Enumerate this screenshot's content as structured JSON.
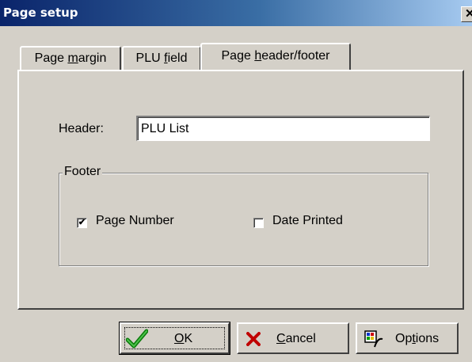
{
  "window": {
    "title": "Page setup",
    "close_glyph": "✕"
  },
  "tabs": [
    {
      "pre": "Page ",
      "hot": "m",
      "post": "argin",
      "active": false
    },
    {
      "pre": "PLU ",
      "hot": "f",
      "post": "ield",
      "active": false
    },
    {
      "pre": "Page ",
      "hot": "h",
      "post": "eader/footer",
      "active": true
    }
  ],
  "header": {
    "label": "Header:",
    "value": "PLU List"
  },
  "footer": {
    "legend": "Footer",
    "page_number": {
      "label": "Page Number",
      "checked": true,
      "check_glyph": "✔"
    },
    "date_printed": {
      "label": "Date Printed",
      "checked": false
    }
  },
  "buttons": {
    "ok": {
      "hot": "O",
      "post": "K",
      "icon": "green-checkmark-icon"
    },
    "cancel": {
      "hot": "C",
      "post": "ancel",
      "icon": "red-x-icon"
    },
    "options": {
      "pre": "Op",
      "hot": "t",
      "post": "ions",
      "icon": "options-icon"
    }
  }
}
